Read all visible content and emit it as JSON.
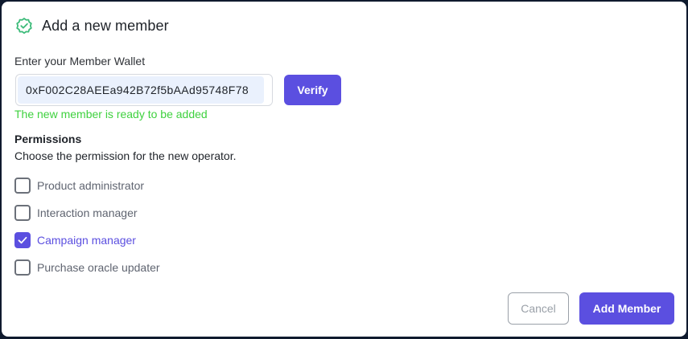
{
  "dialog": {
    "title": "Add a new member",
    "header_icon": "verified-badge-icon"
  },
  "wallet": {
    "label": "Enter your Member Wallet",
    "value": "0xF002C28AEEa942B72f5bAAd95748F78",
    "verify_label": "Verify",
    "status_message": "The new member is ready to be added"
  },
  "permissions": {
    "title": "Permissions",
    "description": "Choose the permission for the new operator.",
    "items": [
      {
        "label": "Product administrator",
        "checked": false
      },
      {
        "label": "Interaction manager",
        "checked": false
      },
      {
        "label": "Campaign manager",
        "checked": true
      },
      {
        "label": "Purchase oracle updater",
        "checked": false
      }
    ]
  },
  "actions": {
    "cancel_label": "Cancel",
    "add_label": "Add Member"
  },
  "colors": {
    "accent": "#5b4fe0",
    "success": "#3ed13e",
    "badge": "#3dbb7a"
  }
}
